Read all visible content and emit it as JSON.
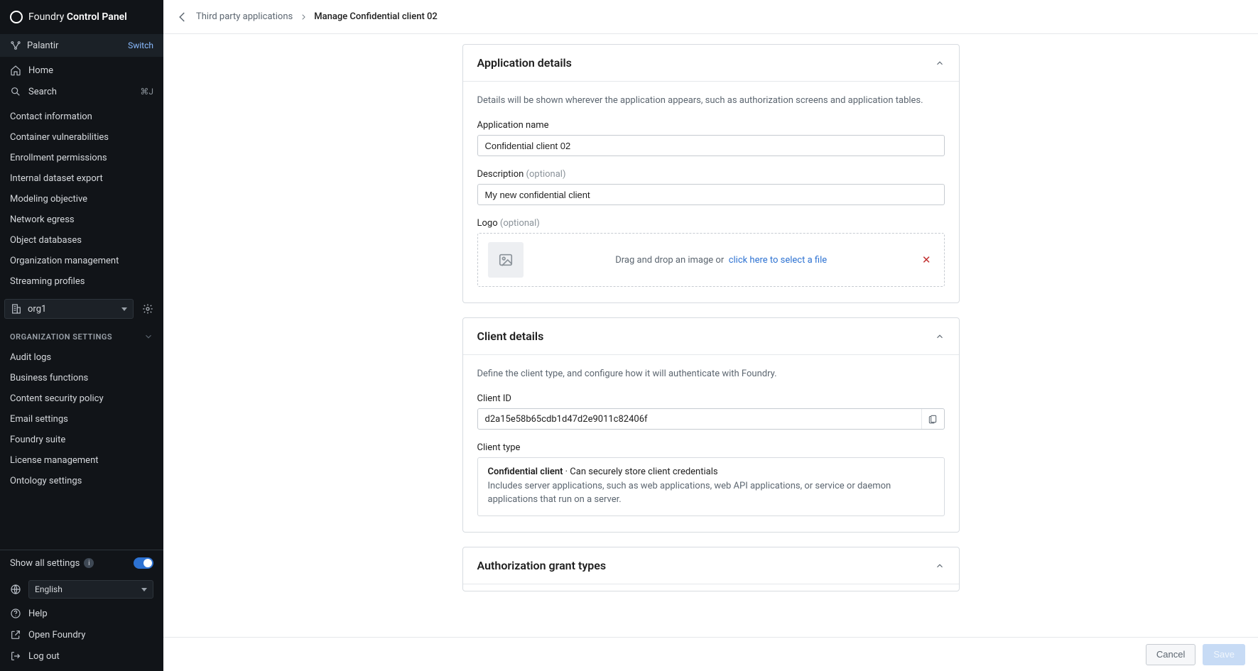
{
  "brand": {
    "name_light": "Foundry",
    "name_bold": "Control Panel"
  },
  "tenant": {
    "name": "Palantir",
    "switch": "Switch"
  },
  "sidebar": {
    "home": "Home",
    "search": "Search",
    "search_kbd": "⌘J",
    "items": [
      "Contact information",
      "Container vulnerabilities",
      "Enrollment permissions",
      "Internal dataset export",
      "Modeling objective",
      "Network egress",
      "Object databases",
      "Organization management",
      "Streaming profiles"
    ],
    "org_selector": "org1",
    "org_section": "ORGANIZATION SETTINGS",
    "org_items": [
      "Audit logs",
      "Business functions",
      "Content security policy",
      "Email settings",
      "Foundry suite",
      "License management",
      "Ontology settings"
    ],
    "show_all": "Show all settings",
    "language": "English",
    "help": "Help",
    "open_foundry": "Open Foundry",
    "logout": "Log out"
  },
  "breadcrumb": {
    "parent": "Third party applications",
    "current": "Manage Confidential client 02"
  },
  "app_details": {
    "header": "Application details",
    "help": "Details will be shown wherever the application appears, such as authorization screens and application tables.",
    "name_label": "Application name",
    "name_value": "Confidential client 02",
    "desc_label": "Description",
    "desc_value": "My new confidential client",
    "logo_label": "Logo",
    "optional": "(optional)",
    "drop_text": "Drag and drop an image or",
    "drop_link": "click here to select a file"
  },
  "client_details": {
    "header": "Client details",
    "help": "Define the client type, and configure how it will authenticate with Foundry.",
    "id_label": "Client ID",
    "id_value": "d2a15e58b65cdb1d47d2e9011c82406f",
    "type_label": "Client type",
    "type_name": "Confidential client",
    "type_short": " · Can securely store client credentials",
    "type_desc": "Includes server applications, such as web applications, web API applications, or service or daemon applications that run on a server."
  },
  "auth_grant": {
    "header": "Authorization grant types"
  },
  "actions": {
    "cancel": "Cancel",
    "save": "Save"
  }
}
